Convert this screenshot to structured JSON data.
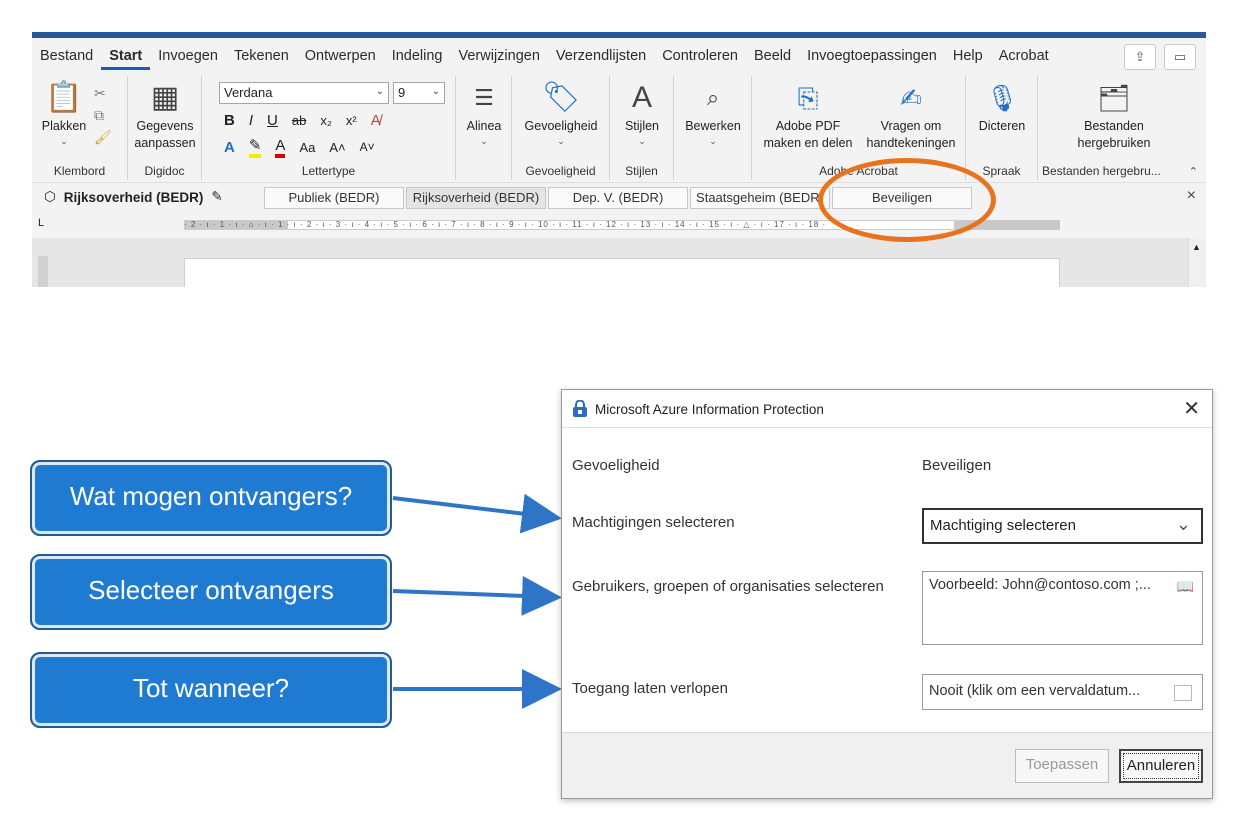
{
  "word": {
    "menu": [
      "Bestand",
      "Start",
      "Invoegen",
      "Tekenen",
      "Ontwerpen",
      "Indeling",
      "Verwijzingen",
      "Verzendlijsten",
      "Controleren",
      "Beeld",
      "Invoegtoepassingen",
      "Help",
      "Acrobat"
    ],
    "active_menu": "Start",
    "ribbon": {
      "paste": "Plakken",
      "klembord": "Klembord",
      "gegevens1": "Gegevens",
      "gegevens2": "aanpassen",
      "digidoc": "Digidoc",
      "font_name": "Verdana",
      "font_size": "9",
      "lettertype": "Lettertype",
      "alinea": "Alinea",
      "gevoeligheid_btn": "Gevoeligheid",
      "gevoeligheid_grp": "Gevoeligheid",
      "stijlen_btn": "Stijlen",
      "stijlen_grp": "Stijlen",
      "bewerken": "Bewerken",
      "adobe1": "Adobe PDF",
      "adobe2": "maken en delen",
      "vragen1": "Vragen om",
      "vragen2": "handtekeningen",
      "adobe_grp": "Adobe Acrobat",
      "dicteren": "Dicteren",
      "spraak": "Spraak",
      "bestanden1": "Bestanden",
      "bestanden2": "hergebruiken",
      "bestanden_grp": "Bestanden hergebru..."
    },
    "labelbar": {
      "current": "Rijksoverheid (BEDR)",
      "labels": [
        "Publiek (BEDR)",
        "Rijksoverheid (BEDR)",
        "Dep. V. (BEDR)",
        "Staatsgeheim (BEDR)",
        "Beveiligen"
      ]
    },
    "ruler_text": "· 2 · ı · 1 · ı · ⌂ · ı · 1 · ı · 2 · ı · 3 · ı · 4 · ı · 5 · ı · 6 · ı · 7 · ı · 8 · ı · 9 · ı · 10 · ı · 11 · ı · 12 · ı · 13 · ı · 14 · ı · 15 · ı · △ · ı · 17 · ı · 18 ·"
  },
  "callouts": [
    "Wat mogen ontvangers?",
    "Selecteer ontvangers",
    "Tot wanneer?"
  ],
  "dialog": {
    "title": "Microsoft Azure Information Protection",
    "gevoeligheid_label": "Gevoeligheid",
    "gevoeligheid_value": "Beveiligen",
    "machtigingen_label": "Machtigingen selecteren",
    "machtiging_value": "Machtiging selecteren",
    "gebruikers_label": "Gebruikers, groepen of organisaties selecteren",
    "gebruikers_placeholder": "Voorbeeld: John@contoso.com ;...",
    "toegang_label": "Toegang laten verlopen",
    "toegang_value": "Nooit (klik om een vervaldatum...",
    "apply": "Toepassen",
    "cancel": "Annuleren"
  },
  "colors": {
    "ellipse": "#e8731e",
    "callout": "#1f7bd1",
    "arrow": "#2e75c7"
  }
}
